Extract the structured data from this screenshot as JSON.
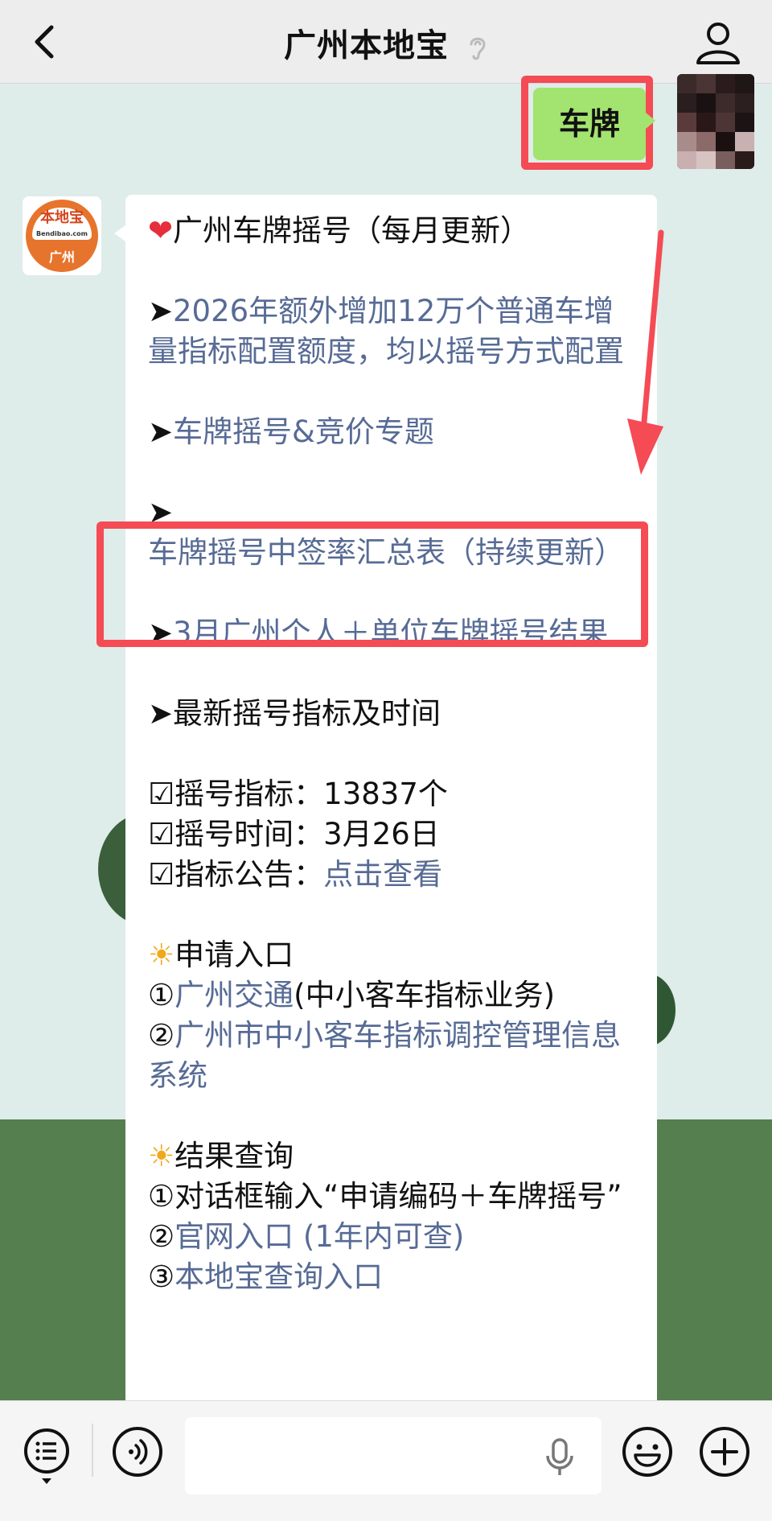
{
  "header": {
    "title": "广州本地宝",
    "back_icon": "chevron-left-icon",
    "ear_icon": "ear-icon",
    "profile_icon": "person-icon"
  },
  "outgoing": {
    "text": "车牌"
  },
  "bot_avatar": {
    "brand": "本地宝",
    "url": "Bendibao.com",
    "city": "广州"
  },
  "message": {
    "title": "广州车牌摇号（每月更新）",
    "link1": "2026年额外增加12万个普通车增量指标配置额度，均以摇号方式配置",
    "link2": "车牌摇号&竞价专题",
    "link3": "车牌摇号中签率汇总表（持续更新）",
    "link4": "3月广州个人＋单位车牌摇号结果",
    "latest": "最新摇号指标及时间",
    "quota_label": "摇号指标：",
    "quota_value": "13837个",
    "time_label": "摇号时间：",
    "time_value": "3月26日",
    "notice_label": "指标公告：",
    "notice_link": "点击查看",
    "apply_title": "申请入口",
    "apply1_link": "广州交通",
    "apply1_note": "(中小客车指标业务)",
    "apply2_link": "广州市中小客车指标调控管理信息系统",
    "result_title": "结果查询",
    "result1": "对话框输入“申请编码＋车牌摇号”",
    "result2_link": "官网入口 (1年内可查)",
    "result3_link": "本地宝查询入口"
  },
  "input_bar": {
    "placeholder": "",
    "menu_icon": "list-menu-icon",
    "voice_icon": "voice-icon",
    "mic_icon": "microphone-icon",
    "emoji_icon": "smile-emoji-icon",
    "plus_icon": "plus-circle-icon"
  },
  "colors": {
    "header_bg": "#ededed",
    "link": "#576b95",
    "outgoing_bubble": "#a3e36f",
    "highlight_red": "#f44b55"
  }
}
